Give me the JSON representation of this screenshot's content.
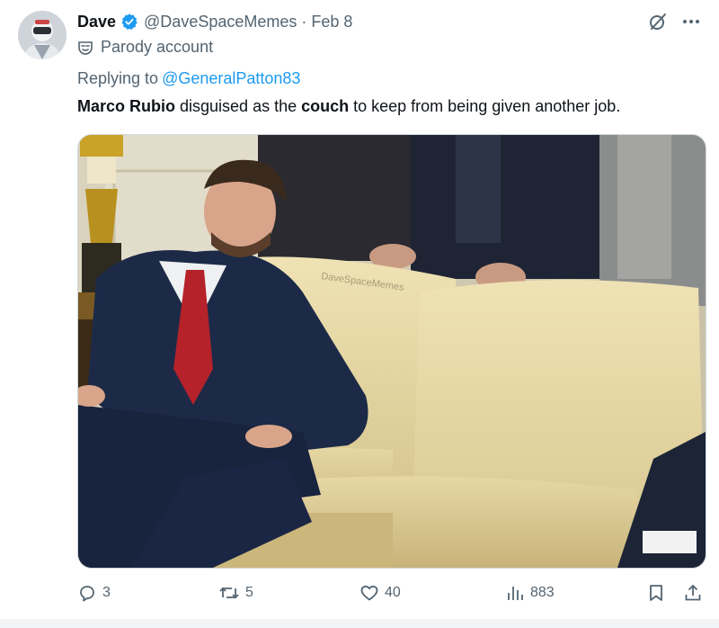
{
  "tweet": {
    "display_name": "Dave",
    "handle": "@DaveSpaceMemes",
    "separator": "·",
    "date": "Feb 8",
    "label": "Parody account",
    "replying_prefix": "Replying to",
    "replying_to": "@GeneralPatton83",
    "text": {
      "part1": "Marco Rubio",
      "part2": " disguised as the ",
      "part3": "couch",
      "part4": " to keep from being given another job."
    },
    "media": {
      "watermark": "DaveSpaceMemes"
    }
  },
  "actions": {
    "replies": "3",
    "reposts": "5",
    "likes": "40",
    "views": "883"
  },
  "icons": {
    "verified": "verified-badge-icon",
    "grok": "grok-icon",
    "more": "more-icon",
    "parody": "parody-mask-icon",
    "reply": "reply-icon",
    "repost": "repost-icon",
    "like": "like-icon",
    "views": "views-icon",
    "bookmark": "bookmark-icon",
    "share": "share-icon"
  },
  "colors": {
    "link": "#1d9bf0",
    "secondary_text": "#536471",
    "primary_text": "#0f1419",
    "verified": "#1d9bf0"
  }
}
